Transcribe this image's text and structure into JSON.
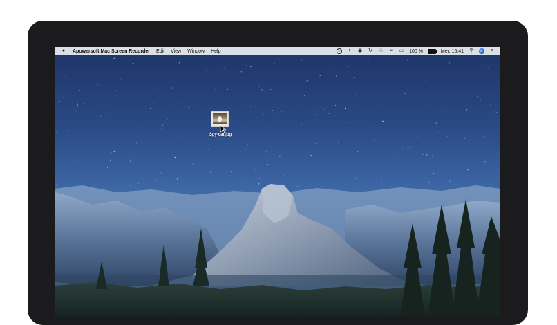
{
  "menubar": {
    "apple_icon": "apple-logo-icon",
    "app_name": "Apowersoft Mac Screen Recorder",
    "menus": [
      "Edit",
      "View",
      "Window",
      "Help"
    ],
    "status_icons": [
      "recorder-icon",
      "bird-icon",
      "eye-icon",
      "sync-icon",
      "bluetooth-icon",
      "wifi-icon",
      "airplay-icon"
    ],
    "battery_percent": "100 %",
    "battery_level": 1.0,
    "clock": "Mer. 15:41",
    "spotlight_icon": "search-icon",
    "siri_icon": "siri-icon",
    "notifications_icon": "notification-center-icon"
  },
  "desktop": {
    "file_name": "Spy-cat.jpg"
  },
  "colors": {
    "sky_top": "#1e3466",
    "horizon": "#8fb0d6",
    "menubar_bg": "#eceef2"
  }
}
